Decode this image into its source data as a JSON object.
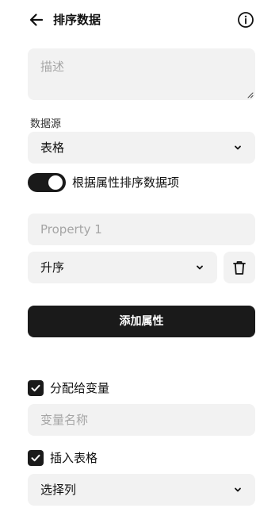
{
  "header": {
    "title": "排序数据",
    "back_icon": "arrow-left-icon",
    "info_icon": "info-circle-icon"
  },
  "description": {
    "placeholder": "描述"
  },
  "data_source": {
    "label": "数据源",
    "selected": "表格"
  },
  "sort_toggle": {
    "label": "根据属性排序数据项",
    "on": true
  },
  "property": {
    "placeholder": "Property 1",
    "order_selected": "升序",
    "delete_icon": "trash-icon"
  },
  "add_property_button": {
    "label": "添加属性"
  },
  "assign_variable": {
    "label": "分配给变量",
    "checked": true,
    "name_placeholder": "变量名称"
  },
  "insert_table": {
    "label": "插入表格",
    "checked": true,
    "column_placeholder": "选择列"
  },
  "colors": {
    "primary": "#1a1a1a",
    "field_bg": "#f2f2f2",
    "placeholder": "#a5a5a5"
  }
}
